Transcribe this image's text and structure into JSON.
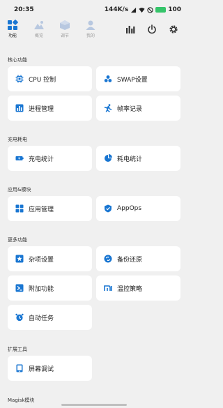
{
  "status": {
    "time": "20:35",
    "speed": "144K/s",
    "battery": "100"
  },
  "tabs": [
    {
      "label": "功能",
      "active": true
    },
    {
      "label": "概览",
      "active": false
    },
    {
      "label": "调节",
      "active": false
    },
    {
      "label": "我的",
      "active": false
    }
  ],
  "sections": [
    {
      "title": "核心功能",
      "items": [
        "CPU 控制",
        "SWAP设置",
        "进程管理",
        "帧率记录"
      ]
    },
    {
      "title": "充电耗电",
      "items": [
        "充电统计",
        "耗电统计"
      ]
    },
    {
      "title": "应用&模块",
      "items": [
        "应用管理",
        "AppOps"
      ]
    },
    {
      "title": "更多功能",
      "items": [
        "杂项设置",
        "备份还原",
        "附加功能",
        "温控策略",
        "自动任务"
      ]
    },
    {
      "title": "扩展工具",
      "items": [
        "屏幕调试"
      ]
    },
    {
      "title": "Magisk模块",
      "items": []
    }
  ],
  "colors": {
    "accent": "#1976d2",
    "background": "#f0f0f0",
    "card": "#ffffff"
  },
  "icons": {
    "cpu": "cpu-icon",
    "swap": "swap-icon",
    "process": "process-icon",
    "fps": "runner-icon",
    "charge": "battery-charge-icon",
    "power": "pie-icon",
    "apps": "grid-icon",
    "appops": "shield-icon",
    "misc": "star-icon",
    "backup": "restore-icon",
    "addin": "terminal-icon",
    "thermal": "mi-icon",
    "task": "alarm-icon",
    "screen": "screen-icon"
  }
}
